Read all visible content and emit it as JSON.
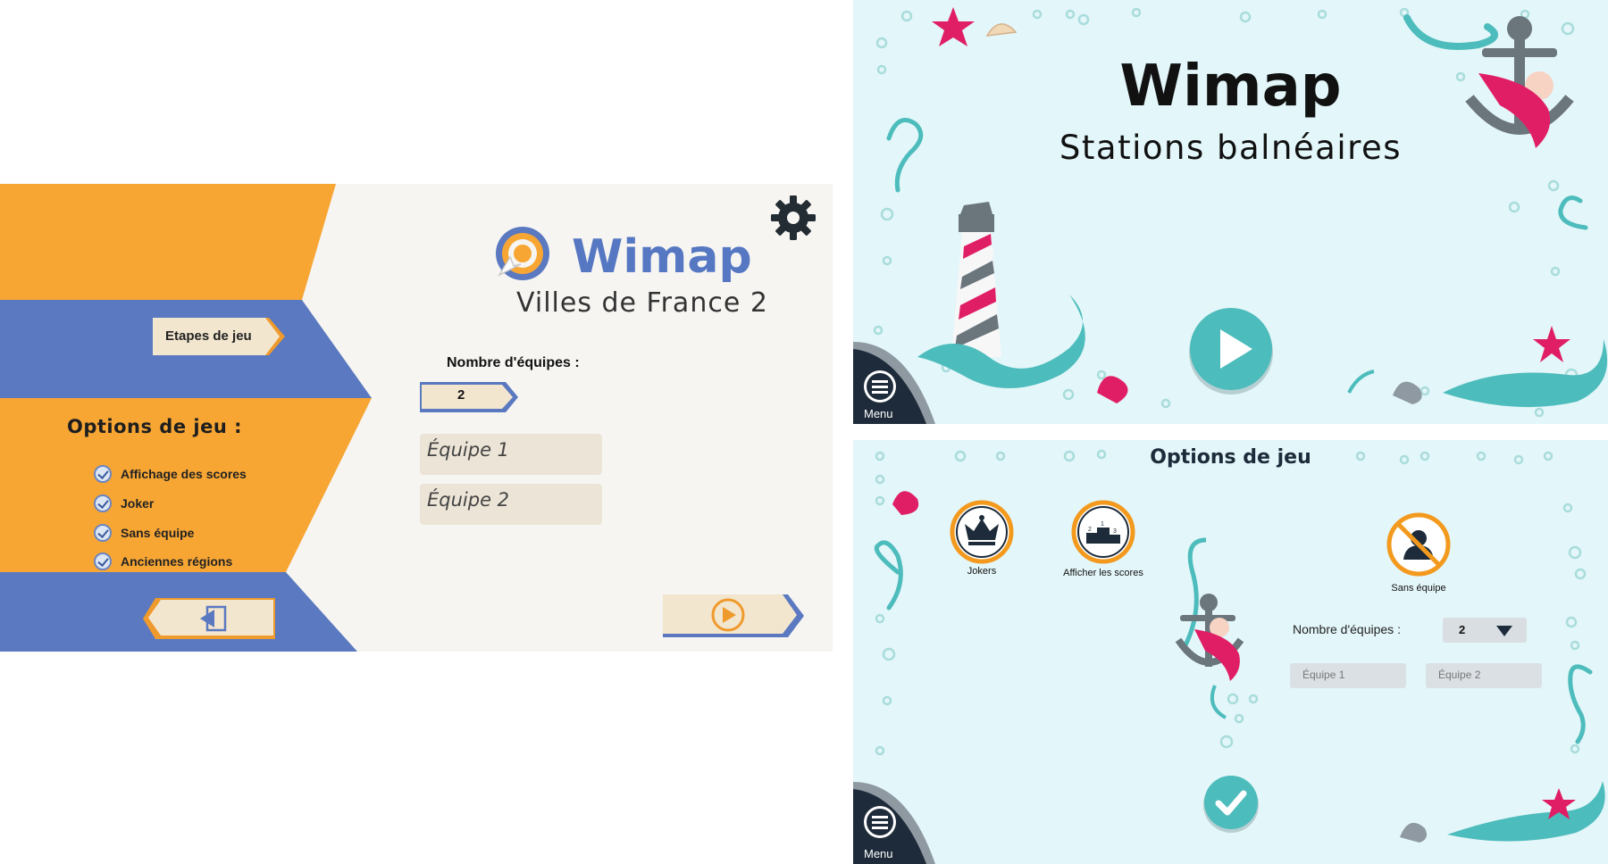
{
  "left_screen": {
    "app_title": "Wimap",
    "subtitle": "Villes de France 2",
    "etapes_button": "Etapes de jeu",
    "options_title": "Options de jeu :",
    "options": [
      {
        "label": "Affichage des scores",
        "checked": true
      },
      {
        "label": "Joker",
        "checked": true
      },
      {
        "label": "Sans équipe",
        "checked": true
      },
      {
        "label": "Anciennes régions",
        "checked": true
      }
    ],
    "nb_equipes_label": "Nombre d'équipes :",
    "nb_equipes_value": "2",
    "teams": [
      "Équipe 1",
      "Équipe 2"
    ],
    "icons": {
      "settings": "gear-icon",
      "exit": "exit-icon",
      "play": "play-icon",
      "logo": "target-cursor-logo"
    },
    "colors": {
      "orange": "#f7a634",
      "blue": "#5a79c0",
      "background": "#f6f5f2",
      "input": "#ece4d6"
    }
  },
  "right_top_screen": {
    "app_title": "Wimap",
    "subtitle": "Stations balnéaires",
    "menu_label": "Menu",
    "icons": {
      "play": "play-icon",
      "menu": "hamburger-icon",
      "lighthouse": "lighthouse-icon",
      "anchor": "anchor-icon"
    },
    "colors": {
      "background": "#e3f6f9",
      "teal": "#4dbcbc",
      "pink": "#e01e65"
    }
  },
  "right_bottom_screen": {
    "options_title": "Options de jeu",
    "options": [
      {
        "label": "Jokers",
        "icon": "crown-icon"
      },
      {
        "label": "Afficher les scores",
        "icon": "podium-icon"
      },
      {
        "label": "Sans équipe",
        "icon": "no-team-icon"
      }
    ],
    "nb_equipes_label": "Nombre d'équipes :",
    "nb_equipes_value": "2",
    "teams": [
      "Équipe 1",
      "Équipe 2"
    ],
    "menu_label": "Menu",
    "icons": {
      "confirm": "check-icon",
      "menu": "hamburger-icon"
    }
  }
}
